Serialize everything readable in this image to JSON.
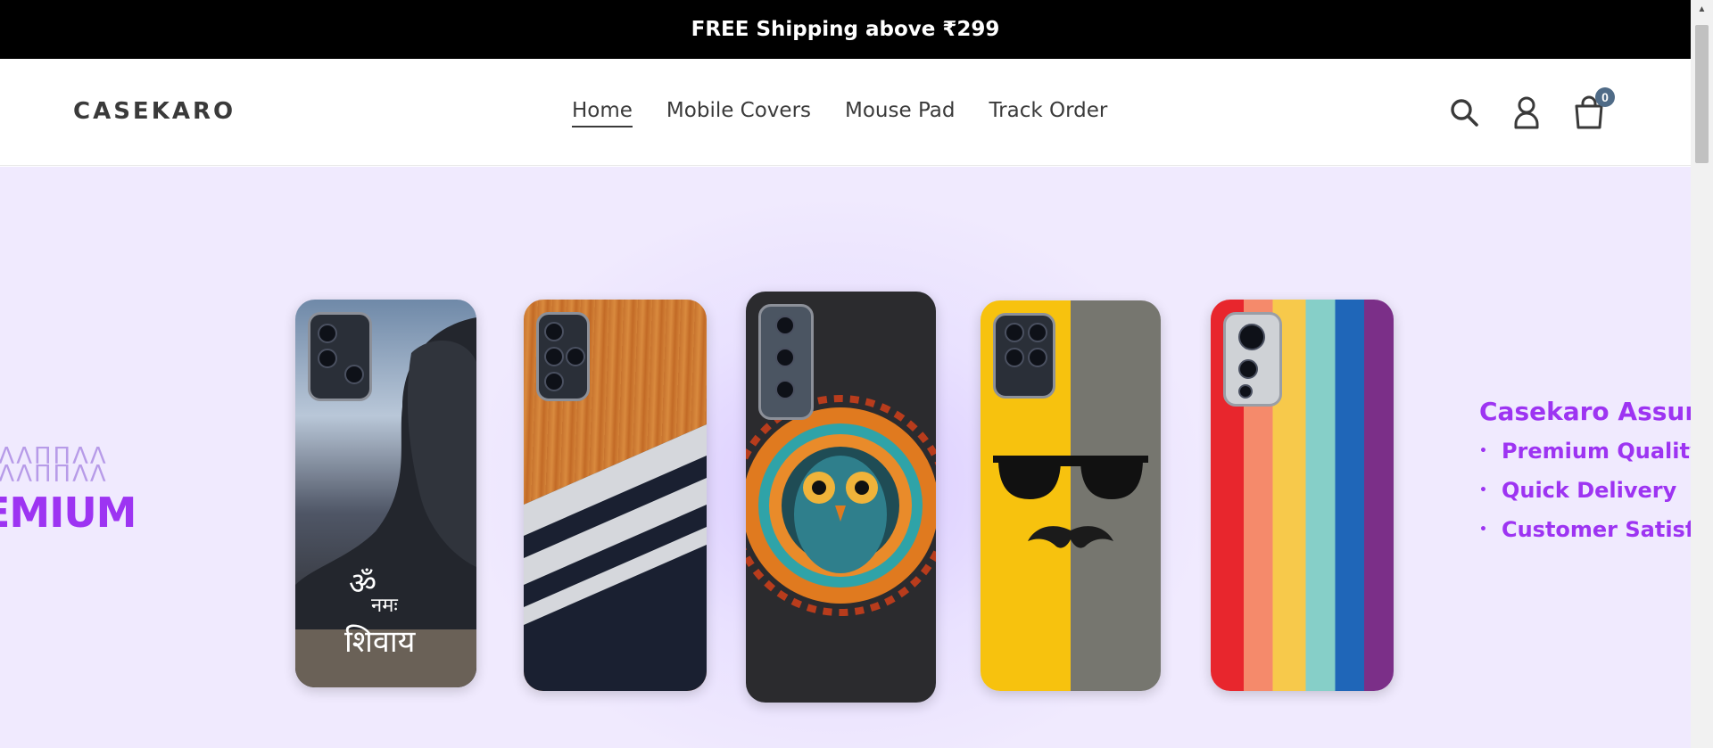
{
  "announcement": {
    "text": "FREE Shipping above ₹299"
  },
  "header": {
    "logo": "CASEKARO",
    "nav": [
      {
        "label": "Home",
        "active": true
      },
      {
        "label": "Mobile Covers",
        "active": false
      },
      {
        "label": "Mouse Pad",
        "active": false
      },
      {
        "label": "Track Order",
        "active": false
      }
    ],
    "icons": {
      "search": "search-icon",
      "account": "user-icon",
      "cart": "cart-icon"
    },
    "cart_count": "0"
  },
  "hero": {
    "left_text": "EMIUM",
    "left_pattern": "ƎΛΛΠΠΛΛ",
    "assure_title": "Casekaro Assure",
    "assure_items": [
      "Premium Quality",
      "Quick Delivery",
      "Customer Satisfaction"
    ],
    "phones": [
      {
        "design": "adiyogi-om-namah-shivaya"
      },
      {
        "design": "wood-stripes"
      },
      {
        "design": "owl-mandala"
      },
      {
        "design": "sunglasses-mustache"
      },
      {
        "design": "rainbow-stripes"
      }
    ],
    "accent_color": "#9d34f2"
  }
}
